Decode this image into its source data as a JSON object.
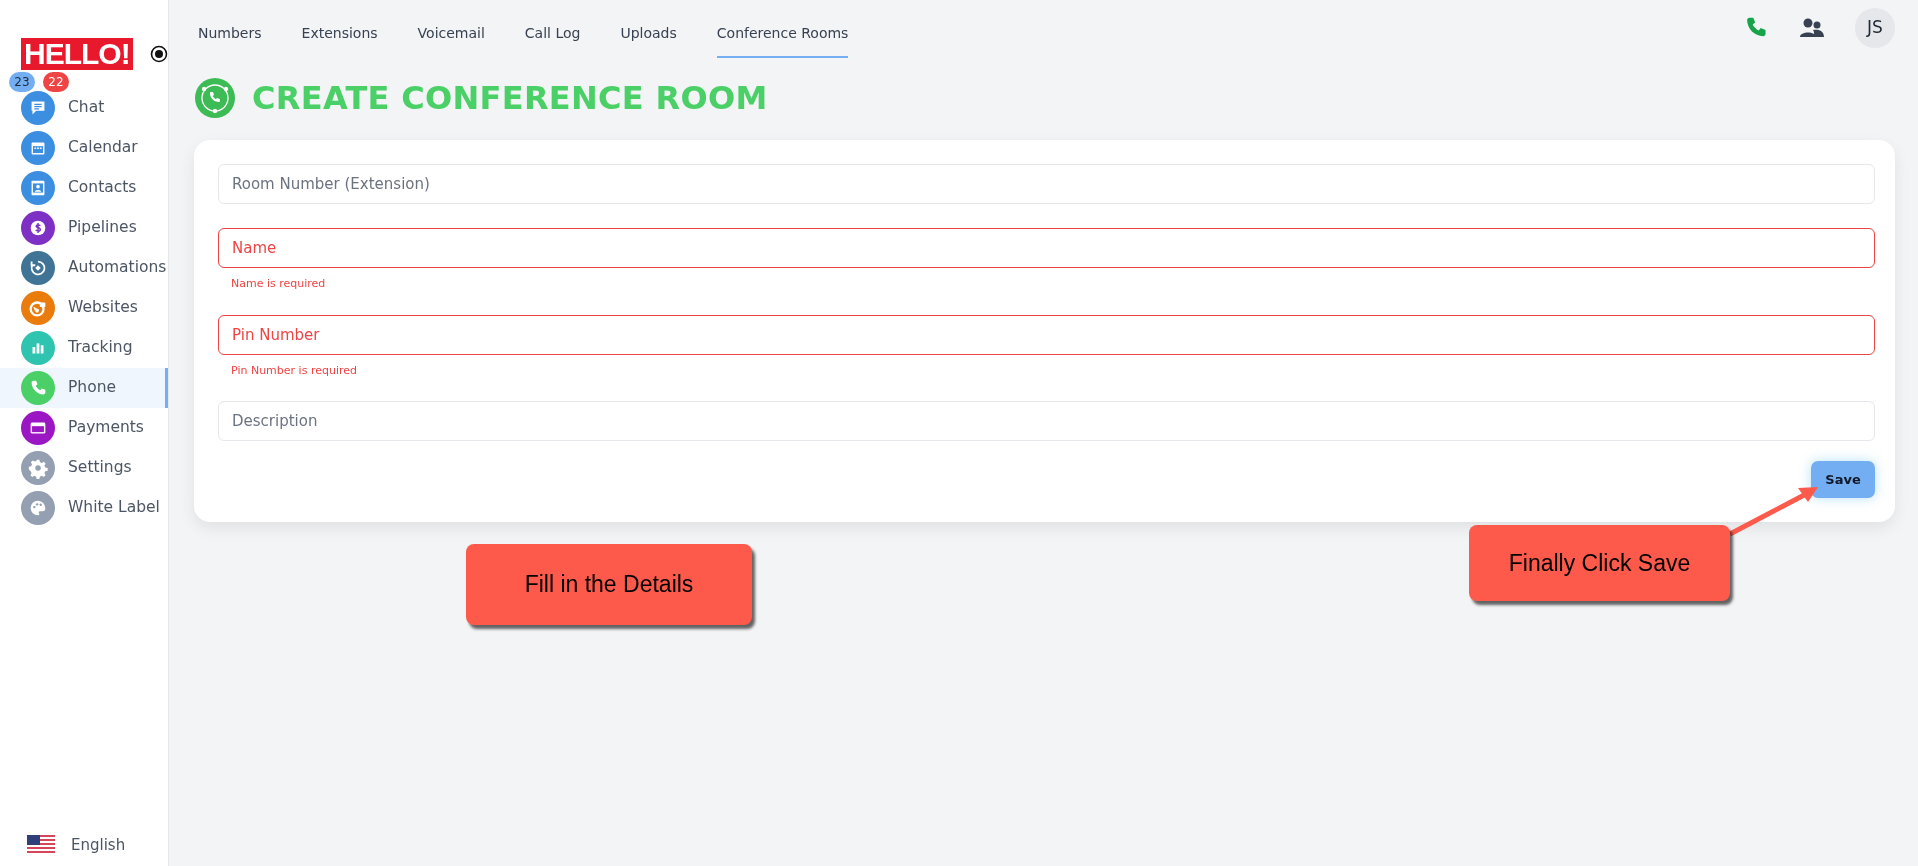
{
  "logo": {
    "text": "HELLO!"
  },
  "sidebar": {
    "items": [
      {
        "label": "Chat",
        "color": "#3b8ee0",
        "selected": false,
        "badges": [
          {
            "text": "23",
            "color": "#74aef2"
          },
          {
            "text": "22",
            "color": "#ef4444"
          }
        ]
      },
      {
        "label": "Calendar",
        "color": "#3b8ee0",
        "selected": false
      },
      {
        "label": "Contacts",
        "color": "#3b8ee0",
        "selected": false
      },
      {
        "label": "Pipelines",
        "color": "#7e2fc4",
        "selected": false
      },
      {
        "label": "Automations",
        "color": "#3f7497",
        "selected": false
      },
      {
        "label": "Websites",
        "color": "#ea7c0d",
        "selected": false
      },
      {
        "label": "Tracking",
        "color": "#2ec4b0",
        "selected": false
      },
      {
        "label": "Phone",
        "color": "#4ad066",
        "selected": true
      },
      {
        "label": "Payments",
        "color": "#9b17c4",
        "selected": false
      },
      {
        "label": "Settings",
        "color": "#949fb1",
        "selected": false
      },
      {
        "label": "White Label",
        "color": "#949fb1",
        "selected": false
      }
    ],
    "language": "English"
  },
  "tabs": [
    {
      "label": "Numbers",
      "selected": false
    },
    {
      "label": "Extensions",
      "selected": false
    },
    {
      "label": "Voicemail",
      "selected": false
    },
    {
      "label": "Call Log",
      "selected": false
    },
    {
      "label": "Uploads",
      "selected": false
    },
    {
      "label": "Conference Rooms",
      "selected": true
    }
  ],
  "user": {
    "initials": "JS"
  },
  "page_title": "CREATE CONFERENCE ROOM",
  "form": {
    "fields": [
      {
        "placeholder": "Room Number (Extension)",
        "invalid": false
      },
      {
        "placeholder": "Name",
        "invalid": true,
        "error": "Name is required"
      },
      {
        "placeholder": "Pin Number",
        "invalid": true,
        "error": "Pin Number is required"
      },
      {
        "placeholder": "Description",
        "invalid": false
      }
    ],
    "save_button": "Save"
  },
  "callouts": [
    {
      "text": "Fill in the Details",
      "arrow": false
    },
    {
      "text": "Finally Click Save",
      "arrow": true
    }
  ]
}
